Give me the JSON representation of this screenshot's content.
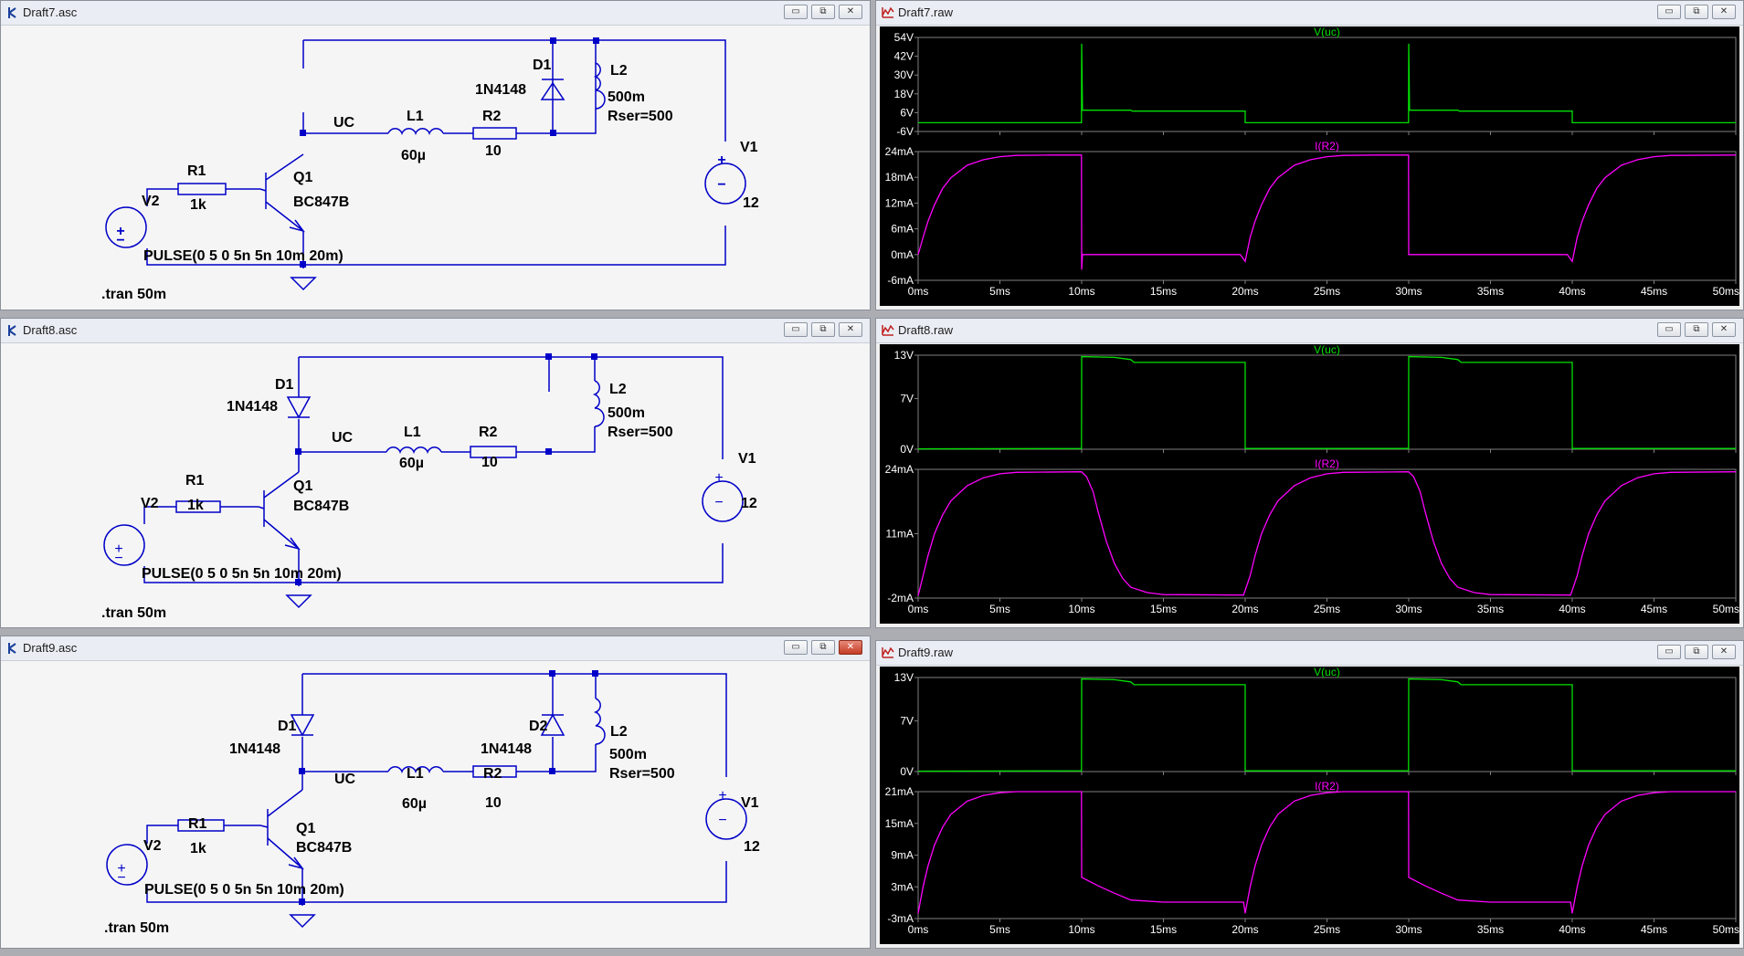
{
  "schematics": [
    {
      "title": "Draft7.asc",
      "labels": {
        "d1": "D1",
        "d1_model": "1N4148",
        "l2": "L2",
        "l2_val": "500m",
        "l2_rser": "Rser=500",
        "uc": "UC",
        "l1": "L1",
        "l1_val": "60µ",
        "r2": "R2",
        "r2_val": "10",
        "q1": "Q1",
        "q1_model": "BC847B",
        "r1": "R1",
        "r1_val": "1k",
        "v2": "V2",
        "v1": "V1",
        "v1_val": "12",
        "pulse": "PULSE(0 5 0 5n 5n 10m 20m)",
        "tran": ".tran 50m"
      }
    },
    {
      "title": "Draft8.asc",
      "labels": {
        "d1": "D1",
        "d1_model": "1N4148",
        "l2": "L2",
        "l2_val": "500m",
        "l2_rser": "Rser=500",
        "uc": "UC",
        "l1": "L1",
        "l1_val": "60µ",
        "r2": "R2",
        "r2_val": "10",
        "q1": "Q1",
        "q1_model": "BC847B",
        "r1": "R1",
        "r1_val": "1k",
        "v2": "V2",
        "v1": "V1",
        "v1_val": "12",
        "pulse": "PULSE(0 5 0 5n 5n 10m 20m)",
        "tran": ".tran 50m"
      }
    },
    {
      "title": "Draft9.asc",
      "labels": {
        "d1": "D1",
        "d1_model": "1N4148",
        "d2": "D2",
        "d2_model": "1N4148",
        "l2": "L2",
        "l2_val": "500m",
        "l2_rser": "Rser=500",
        "uc": "UC",
        "l1": "L1",
        "l1_val": "60µ",
        "r2": "R2",
        "r2_val": "10",
        "q1": "Q1",
        "q1_model": "BC847B",
        "r1": "R1",
        "r1_val": "1k",
        "v2": "V2",
        "v1": "V1",
        "v1_val": "12",
        "pulse": "PULSE(0 5 0 5n 5n 10m 20m)",
        "tran": ".tran 50m"
      }
    }
  ],
  "window_controls": {
    "minimize": "▭",
    "restore": "⧉",
    "close": "✕"
  },
  "colors": {
    "voltage_trace": "#00e000",
    "current_trace": "#ff00ff",
    "schematic_wire": "#0000c8",
    "plot_grid": "#808080",
    "plot_bg": "#000000"
  },
  "chart_data": [
    {
      "title": "Draft7.raw",
      "type": "line",
      "x_ticks": [
        "0ms",
        "5ms",
        "10ms",
        "15ms",
        "20ms",
        "25ms",
        "30ms",
        "35ms",
        "40ms",
        "45ms",
        "50ms"
      ],
      "xlim": [
        0,
        50
      ],
      "panes": [
        {
          "trace": "V(uc)",
          "ylim": [
            -6,
            54
          ],
          "y_ticks": [
            "54V",
            "42V",
            "30V",
            "18V",
            "6V",
            "-6V"
          ],
          "y_tick_values": [
            54,
            42,
            30,
            18,
            6,
            -6
          ],
          "points": [
            [
              0,
              -0.4
            ],
            [
              9.99,
              -0.4
            ],
            [
              10,
              50
            ],
            [
              10.05,
              7.6
            ],
            [
              13,
              7.6
            ],
            [
              13.1,
              7.0
            ],
            [
              20,
              7.0
            ],
            [
              20,
              -0.4
            ],
            [
              29.99,
              -0.4
            ],
            [
              30,
              50
            ],
            [
              30.05,
              7.6
            ],
            [
              33,
              7.6
            ],
            [
              33.1,
              7.0
            ],
            [
              40,
              7.0
            ],
            [
              40,
              -0.4
            ],
            [
              50,
              -0.4
            ]
          ]
        },
        {
          "trace": "I(R2)",
          "ylim": [
            -6,
            24
          ],
          "y_ticks": [
            "24mA",
            "18mA",
            "12mA",
            "6mA",
            "0mA",
            "-6mA"
          ],
          "y_tick_values": [
            24,
            18,
            12,
            6,
            0,
            -6
          ],
          "points": [
            [
              0,
              0
            ],
            [
              0.3,
              4.0
            ],
            [
              0.6,
              7.7
            ],
            [
              1,
              11.6
            ],
            [
              1.5,
              15.4
            ],
            [
              2,
              17.9
            ],
            [
              3,
              20.8
            ],
            [
              4,
              22.1
            ],
            [
              5,
              22.8
            ],
            [
              6,
              23.1
            ],
            [
              8,
              23.2
            ],
            [
              9.99,
              23.2
            ],
            [
              10,
              -3.5
            ],
            [
              10.05,
              0
            ],
            [
              19.7,
              0
            ],
            [
              20,
              -1.6
            ],
            [
              20.3,
              4.0
            ],
            [
              20.6,
              7.7
            ],
            [
              21,
              11.6
            ],
            [
              21.5,
              15.4
            ],
            [
              22,
              17.9
            ],
            [
              23,
              20.8
            ],
            [
              24,
              22.1
            ],
            [
              25,
              22.8
            ],
            [
              26,
              23.1
            ],
            [
              28,
              23.2
            ],
            [
              29.99,
              23.2
            ],
            [
              30,
              0
            ],
            [
              39.7,
              0
            ],
            [
              40,
              -1.6
            ],
            [
              40.3,
              4.0
            ],
            [
              40.6,
              7.7
            ],
            [
              41,
              11.6
            ],
            [
              41.5,
              15.4
            ],
            [
              42,
              17.9
            ],
            [
              43,
              20.8
            ],
            [
              44,
              22.1
            ],
            [
              45,
              22.8
            ],
            [
              46,
              23.1
            ],
            [
              50,
              23.2
            ]
          ]
        }
      ]
    },
    {
      "title": "Draft8.raw",
      "type": "line",
      "x_ticks": [
        "0ms",
        "5ms",
        "10ms",
        "15ms",
        "20ms",
        "25ms",
        "30ms",
        "35ms",
        "40ms",
        "45ms",
        "50ms"
      ],
      "xlim": [
        0,
        50
      ],
      "panes": [
        {
          "trace": "V(uc)",
          "ylim": [
            0,
            13
          ],
          "y_ticks": [
            "13V",
            "7V",
            "0V"
          ],
          "y_tick_values": [
            13,
            7,
            0
          ],
          "points": [
            [
              0,
              0.05
            ],
            [
              9.99,
              0.1
            ],
            [
              10,
              12.8
            ],
            [
              12,
              12.7
            ],
            [
              13,
              12.4
            ],
            [
              13.2,
              12.0
            ],
            [
              20,
              12.0
            ],
            [
              20,
              0.1
            ],
            [
              29.99,
              0.1
            ],
            [
              30,
              12.8
            ],
            [
              32,
              12.7
            ],
            [
              33,
              12.4
            ],
            [
              33.2,
              12.0
            ],
            [
              40,
              12.0
            ],
            [
              40,
              0.1
            ],
            [
              50,
              0.1
            ]
          ]
        },
        {
          "trace": "I(R2)",
          "ylim": [
            -2,
            24
          ],
          "y_ticks": [
            "24mA",
            "11mA",
            "-2mA"
          ],
          "y_tick_values": [
            24,
            11,
            -2
          ],
          "points": [
            [
              0,
              -1.5
            ],
            [
              0.3,
              2.5
            ],
            [
              0.6,
              6.5
            ],
            [
              1,
              11
            ],
            [
              1.5,
              14.8
            ],
            [
              2,
              17.6
            ],
            [
              3,
              20.7
            ],
            [
              4,
              22.3
            ],
            [
              5,
              23.1
            ],
            [
              6,
              23.4
            ],
            [
              9.99,
              23.5
            ],
            [
              10.3,
              22.5
            ],
            [
              10.7,
              19.5
            ],
            [
              11,
              15.5
            ],
            [
              11.5,
              9.5
            ],
            [
              12,
              5.0
            ],
            [
              12.5,
              2.0
            ],
            [
              13,
              0.2
            ],
            [
              14,
              -0.9
            ],
            [
              15,
              -1.3
            ],
            [
              19.9,
              -1.4
            ],
            [
              20.3,
              2.5
            ],
            [
              20.6,
              6.5
            ],
            [
              21,
              11
            ],
            [
              21.5,
              14.8
            ],
            [
              22,
              17.6
            ],
            [
              23,
              20.7
            ],
            [
              24,
              22.3
            ],
            [
              25,
              23.1
            ],
            [
              26,
              23.4
            ],
            [
              29.99,
              23.5
            ],
            [
              30.3,
              22.5
            ],
            [
              30.7,
              19.5
            ],
            [
              31,
              15.5
            ],
            [
              31.5,
              9.5
            ],
            [
              32,
              5.0
            ],
            [
              32.5,
              2.0
            ],
            [
              33,
              0.2
            ],
            [
              34,
              -0.9
            ],
            [
              35,
              -1.3
            ],
            [
              39.9,
              -1.4
            ],
            [
              40.3,
              2.5
            ],
            [
              40.6,
              6.5
            ],
            [
              41,
              11
            ],
            [
              41.5,
              14.8
            ],
            [
              42,
              17.6
            ],
            [
              43,
              20.7
            ],
            [
              44,
              22.3
            ],
            [
              45,
              23.1
            ],
            [
              46,
              23.4
            ],
            [
              50,
              23.5
            ]
          ]
        }
      ]
    },
    {
      "title": "Draft9.raw",
      "type": "line",
      "x_ticks": [
        "0ms",
        "5ms",
        "10ms",
        "15ms",
        "20ms",
        "25ms",
        "30ms",
        "35ms",
        "40ms",
        "45ms",
        "50ms"
      ],
      "xlim": [
        0,
        50
      ],
      "panes": [
        {
          "trace": "V(uc)",
          "ylim": [
            0,
            13
          ],
          "y_ticks": [
            "13V",
            "7V",
            "0V"
          ],
          "y_tick_values": [
            13,
            7,
            0
          ],
          "points": [
            [
              0,
              0.05
            ],
            [
              9.99,
              0.1
            ],
            [
              10,
              12.8
            ],
            [
              12,
              12.7
            ],
            [
              13,
              12.4
            ],
            [
              13.2,
              12.0
            ],
            [
              20,
              12.0
            ],
            [
              20,
              0.1
            ],
            [
              29.99,
              0.1
            ],
            [
              30,
              12.8
            ],
            [
              32,
              12.7
            ],
            [
              33,
              12.4
            ],
            [
              33.2,
              12.0
            ],
            [
              40,
              12.0
            ],
            [
              40,
              0.1
            ],
            [
              50,
              0.1
            ]
          ]
        },
        {
          "trace": "I(R2)",
          "ylim": [
            -3,
            21
          ],
          "y_ticks": [
            "21mA",
            "15mA",
            "9mA",
            "3mA",
            "-3mA"
          ],
          "y_tick_values": [
            21,
            15,
            9,
            3,
            -3
          ],
          "points": [
            [
              0,
              -2.0
            ],
            [
              0.3,
              3.0
            ],
            [
              0.6,
              6.9
            ],
            [
              1,
              10.9
            ],
            [
              1.5,
              14.3
            ],
            [
              2,
              16.7
            ],
            [
              3,
              19.2
            ],
            [
              4,
              20.3
            ],
            [
              5,
              20.8
            ],
            [
              6,
              21.0
            ],
            [
              9.99,
              21.0
            ],
            [
              10,
              4.8
            ],
            [
              11,
              3.2
            ],
            [
              12,
              1.8
            ],
            [
              13,
              0.5
            ],
            [
              15,
              0.1
            ],
            [
              19.9,
              0.1
            ],
            [
              20,
              -2.0
            ],
            [
              20.3,
              3.0
            ],
            [
              20.6,
              6.9
            ],
            [
              21,
              10.9
            ],
            [
              21.5,
              14.3
            ],
            [
              22,
              16.7
            ],
            [
              23,
              19.2
            ],
            [
              24,
              20.3
            ],
            [
              25,
              20.8
            ],
            [
              26,
              21.0
            ],
            [
              29.99,
              21.0
            ],
            [
              30,
              4.8
            ],
            [
              31,
              3.2
            ],
            [
              32,
              1.8
            ],
            [
              33,
              0.5
            ],
            [
              35,
              0.1
            ],
            [
              39.9,
              0.1
            ],
            [
              40,
              -2.0
            ],
            [
              40.3,
              3.0
            ],
            [
              40.6,
              6.9
            ],
            [
              41,
              10.9
            ],
            [
              41.5,
              14.3
            ],
            [
              42,
              16.7
            ],
            [
              43,
              19.2
            ],
            [
              44,
              20.3
            ],
            [
              45,
              20.8
            ],
            [
              46,
              21.0
            ],
            [
              50,
              21.0
            ]
          ]
        }
      ]
    }
  ]
}
